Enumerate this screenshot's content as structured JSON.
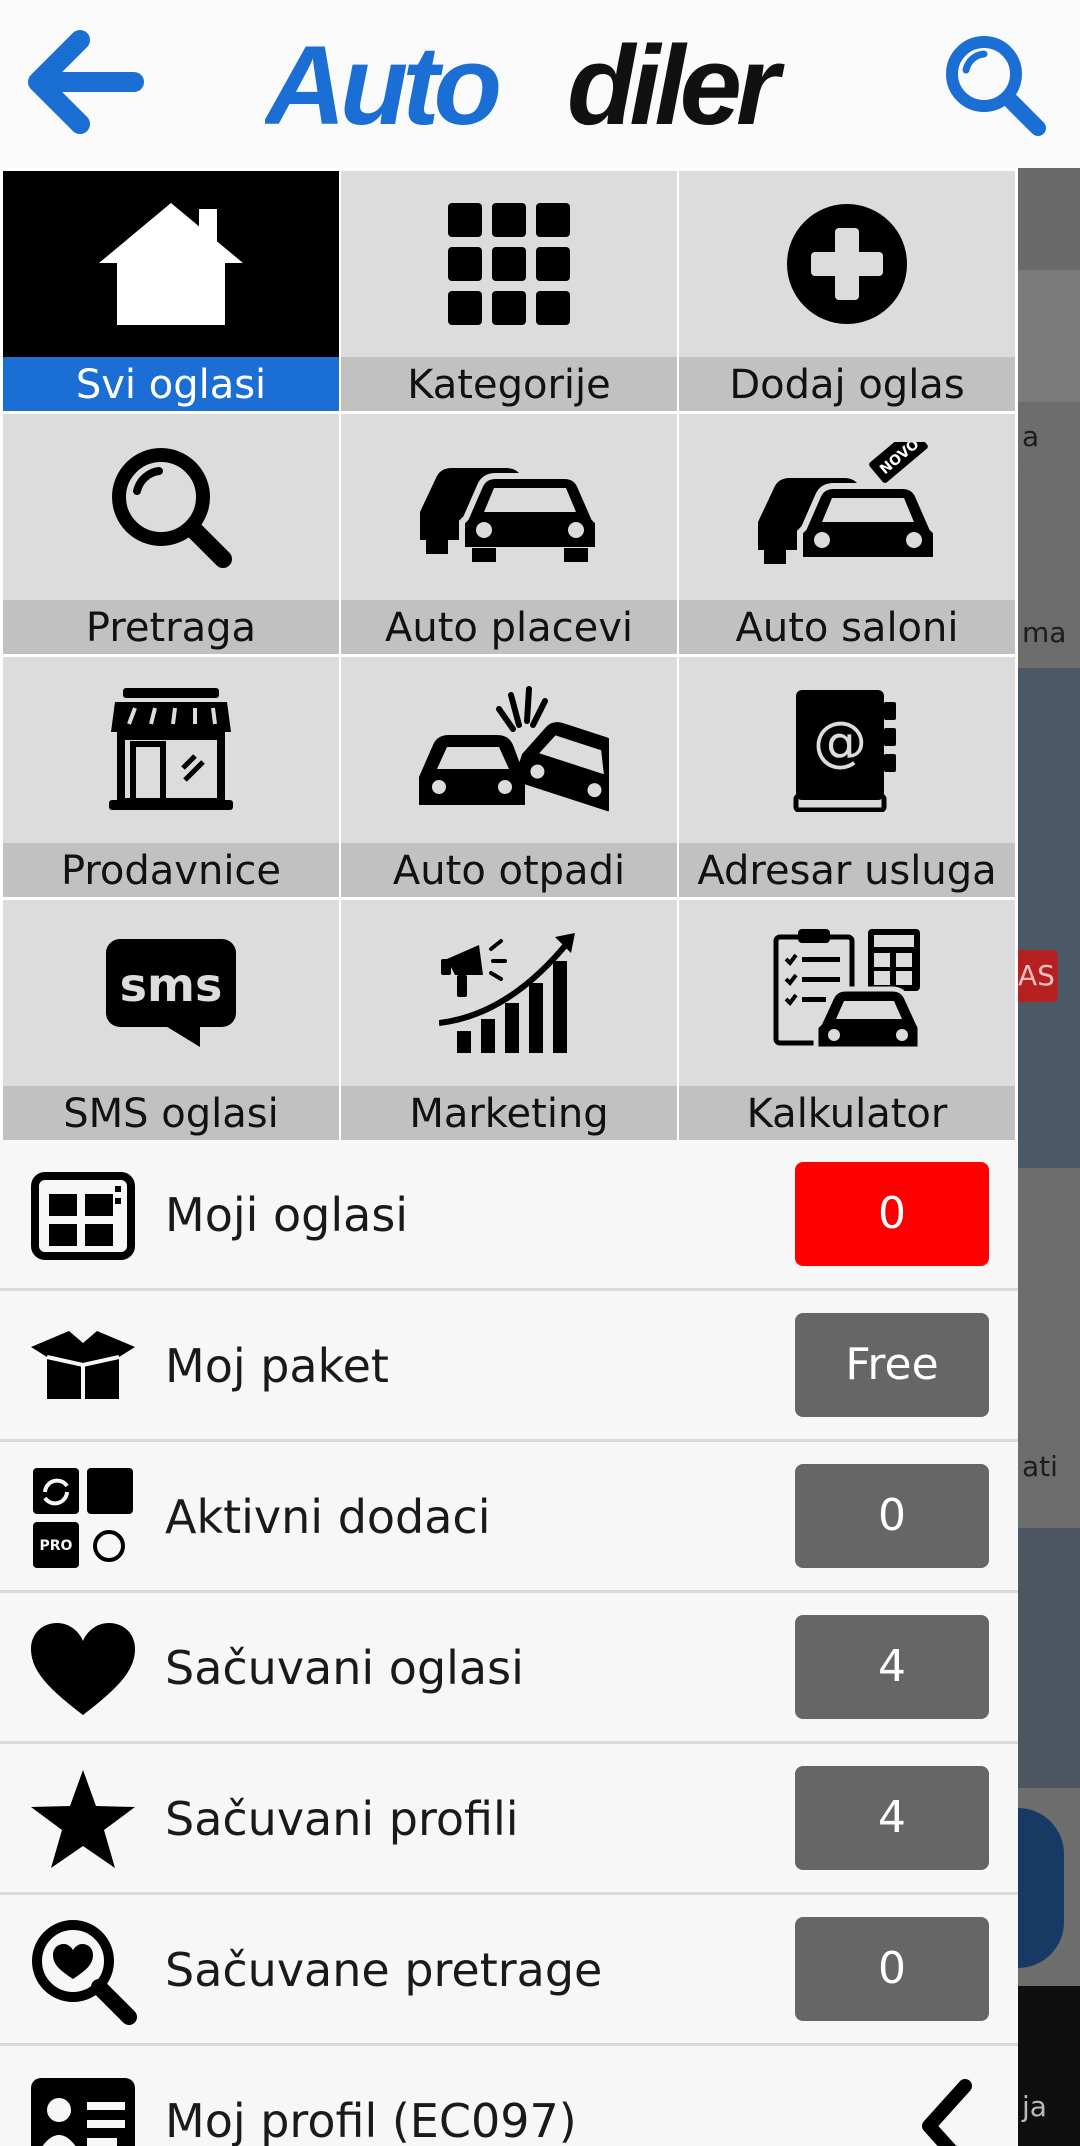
{
  "header": {
    "logo_part1": "Auto",
    "logo_part2": "diler",
    "back_icon": "back-arrow-icon",
    "search_icon": "search-icon"
  },
  "colors": {
    "brand_blue": "#1b6fd4",
    "active_tile_bg": "#000000",
    "tile_bg": "#dcdcdc",
    "tile_label_bg": "#c1c1c1",
    "badge_gray": "#666666",
    "badge_red": "#ff0000"
  },
  "grid": {
    "tiles": [
      {
        "label": "Svi oglasi",
        "icon": "house-icon",
        "active": true
      },
      {
        "label": "Kategorije",
        "icon": "grid-icon"
      },
      {
        "label": "Dodaj oglas",
        "icon": "plus-circle-icon"
      },
      {
        "label": "Pretraga",
        "icon": "magnifier-icon"
      },
      {
        "label": "Auto placevi",
        "icon": "cars-icon"
      },
      {
        "label": "Auto saloni",
        "icon": "cars-new-tag-icon",
        "tag": "NOVO"
      },
      {
        "label": "Prodavnice",
        "icon": "storefront-icon"
      },
      {
        "label": "Auto otpadi",
        "icon": "car-crash-icon"
      },
      {
        "label": "Adresar usluga",
        "icon": "address-book-icon",
        "glyph": "@"
      },
      {
        "label": "SMS oglasi",
        "icon": "sms-bubble-icon",
        "glyph": "sms"
      },
      {
        "label": "Marketing",
        "icon": "marketing-growth-icon"
      },
      {
        "label": "Kalkulator",
        "icon": "calculator-car-icon"
      }
    ]
  },
  "menu": {
    "rows": [
      {
        "label": "Moji oglasi",
        "icon": "listing-board-icon",
        "badge": "0",
        "badge_color": "red"
      },
      {
        "label": "Moj paket",
        "icon": "open-box-icon",
        "badge": "Free"
      },
      {
        "label": "Aktivni dodaci",
        "icon": "puzzle-addons-icon",
        "badge": "0",
        "icon_text": "PRO"
      },
      {
        "label": "Sačuvani oglasi",
        "icon": "heart-icon",
        "badge": "4"
      },
      {
        "label": "Sačuvani profili",
        "icon": "star-icon",
        "badge": "4"
      },
      {
        "label": "Sačuvane pretrage",
        "icon": "heart-search-icon",
        "badge": "0"
      },
      {
        "label": "Moj profil (EC097)",
        "icon": "profile-card-icon",
        "chevron": "chevron-left-icon"
      }
    ]
  },
  "background": {
    "snippets": [
      "a",
      "ma",
      "AS",
      "ati",
      "ja"
    ]
  }
}
